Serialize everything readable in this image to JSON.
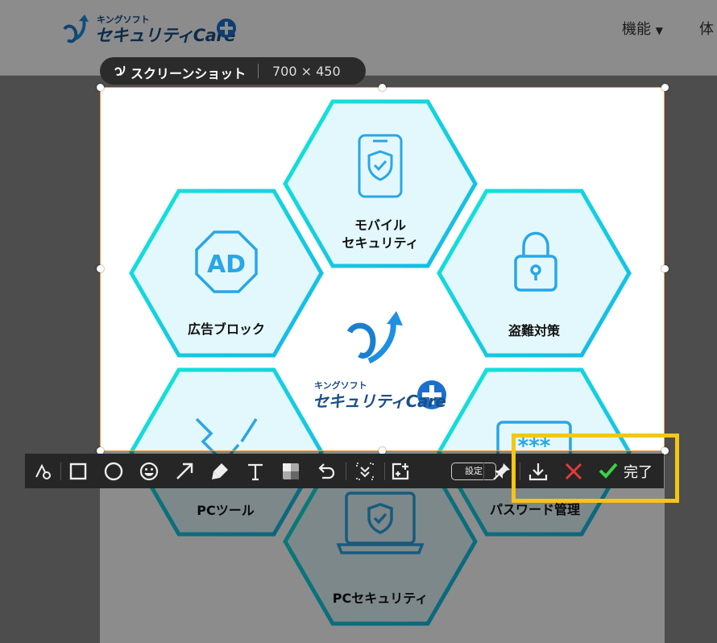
{
  "site": {
    "logo_small": "キングソフト",
    "logo_big": "セキュリティCare",
    "nav_features": "機能",
    "nav_next": "体"
  },
  "capture": {
    "title": "スクリーンショット",
    "size": "700 × 450"
  },
  "graphic": {
    "hex_mobile_line1": "モバイル",
    "hex_mobile_line2": "セキュリティ",
    "hex_ad": "広告ブロック",
    "hex_ad_icon_text": "AD",
    "hex_theft": "盗難対策",
    "hex_pctool": "PCツール",
    "hex_password": "パスワード管理",
    "hex_pc": "PCセキュリティ",
    "password_icon_text": "***",
    "center_logo_small": "キングソフト",
    "center_logo_big": "セキュリティCare"
  },
  "toolbar": {
    "settings_label": "設定",
    "done_label": "完了",
    "tools": [
      "shapes-icon",
      "rectangle-icon",
      "circle-icon",
      "emoji-icon",
      "arrow-icon",
      "marker-icon",
      "text-icon",
      "mosaic-icon",
      "undo-icon",
      "scroll-capture-icon",
      "add-frame-icon",
      "settings",
      "pin-icon",
      "download-icon",
      "close-icon",
      "done"
    ]
  },
  "colors": {
    "hex_border_cyan": "#1ad9e6",
    "hex_fill": "#e3f8fc",
    "toolbar_bg": "#262626",
    "highlight": "#f5c518",
    "selection_border": "#f0a040",
    "check_green": "#3bd14a",
    "close_red": "#e33b3b"
  }
}
